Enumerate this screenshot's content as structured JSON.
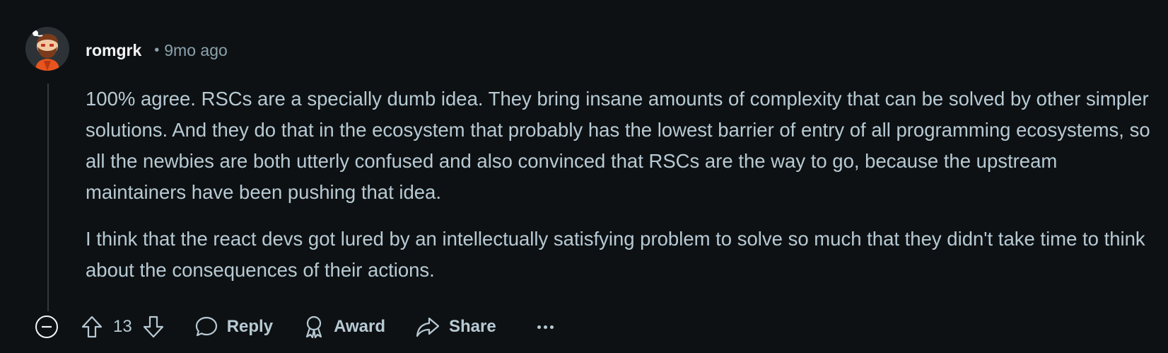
{
  "comment": {
    "author": "romgrk",
    "separator": "•",
    "age": "9mo ago",
    "paragraphs": [
      "100% agree. RSCs are a specially dumb idea. They bring insane amounts of complexity that can be solved by other simpler solutions. And they do that in the ecosystem that probably has the lowest barrier of entry of all programming ecosystems, so all the newbies are both utterly confused and also convinced that RSCs are the way to go, because the upstream maintainers have been pushing that idea.",
      "I think that the react devs got lured by an intellectually satisfying problem to solve so much that they didn't take time to think about the consequences of their actions."
    ],
    "score": "13"
  },
  "actions": {
    "reply_label": "Reply",
    "award_label": "Award",
    "share_label": "Share"
  },
  "icons": {
    "collapse": "minus-circle-icon",
    "upvote": "arrow-up-icon",
    "downvote": "arrow-down-icon",
    "reply": "speech-bubble-icon",
    "award": "award-ribbon-icon",
    "share": "share-arrow-icon",
    "more": "ellipsis-icon"
  },
  "colors": {
    "background": "#0e1113",
    "text": "#b7cad4",
    "username": "#f2f4f5",
    "muted": "#8ba2ad"
  }
}
